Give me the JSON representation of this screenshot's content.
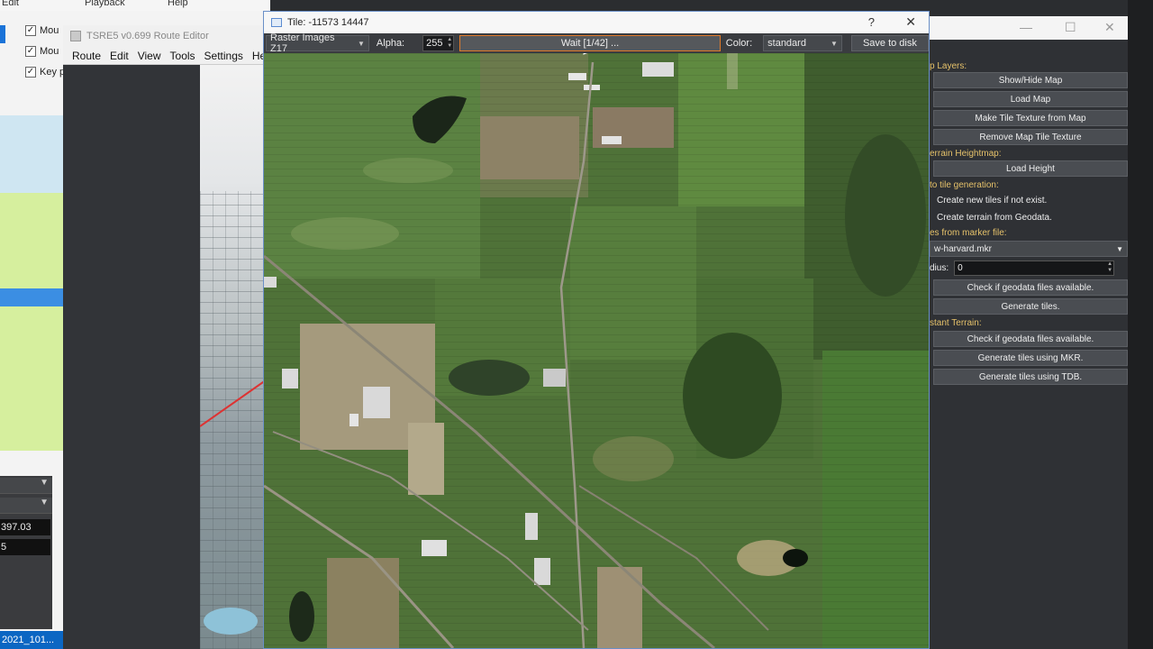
{
  "bg_left": {
    "menu": [
      "Edit",
      "Playback",
      "Help"
    ],
    "checkboxes": [
      {
        "label": "Mou",
        "checked": true
      },
      {
        "label": "Mou",
        "checked": true
      },
      {
        "label": "Key p",
        "checked": true
      }
    ],
    "values": [
      "397.03",
      "5"
    ],
    "file_label": "2021_101..."
  },
  "tsre": {
    "title": "TSRE5 v0.699 Route Editor",
    "menu": [
      "Route",
      "Edit",
      "View",
      "Tools",
      "Settings",
      "He"
    ]
  },
  "tile": {
    "title": "Tile: -11573 14447",
    "help_glyph": "?",
    "close_glyph": "✕",
    "layer_select": "Raster Images Z17",
    "alpha_label": "Alpha:",
    "alpha_value": "255",
    "progress_text": "Wait [1/42] ...",
    "progress_fraction": 0.024,
    "color_label": "Color:",
    "color_select": "standard",
    "save_button": "Save to disk"
  },
  "right_panel": {
    "map_layers_label": "p Layers:",
    "show_hide_map": "Show/Hide Map",
    "load_map": "Load Map",
    "make_tile_texture": "Make Tile Texture from Map",
    "remove_map_tile_texture": "Remove Map Tile Texture",
    "terrain_heightmap_label": "errain Heightmap:",
    "load_height": "Load Height",
    "auto_tile_label": "to tile generation:",
    "create_new_tiles": "Create new tiles if not exist.",
    "create_terrain_geodata": "Create terrain from Geodata.",
    "tiles_from_marker_label": "es from marker file:",
    "marker_file": "w-harvard.mkr",
    "radius_label": "dius:",
    "radius_value": "0",
    "check_geodata_1": "Check if geodata files available.",
    "generate_tiles_1": "Generate tiles.",
    "distant_terrain_label": "stant Terrain:",
    "check_geodata_2": "Check if geodata files available.",
    "generate_tiles_mkr": "Generate tiles using MKR.",
    "generate_tiles_tdb": "Generate tiles using TDB."
  },
  "colors": {
    "section_label": "#e5c16a",
    "progress_border": "#e07a2a",
    "map_grass": "#4a6b35"
  }
}
